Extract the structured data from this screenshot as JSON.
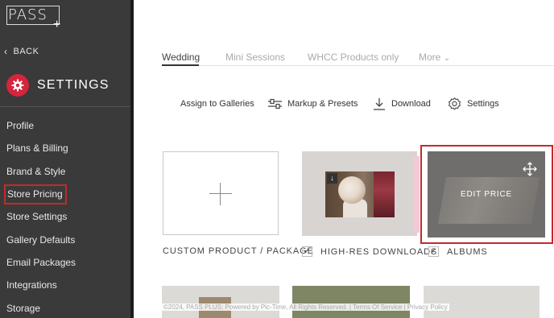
{
  "logo": {
    "text": "PASS",
    "plus": "+"
  },
  "sidebar": {
    "back_label": "BACK",
    "section_title": "SETTINGS",
    "items": [
      {
        "label": "Profile"
      },
      {
        "label": "Plans & Billing"
      },
      {
        "label": "Brand & Style"
      },
      {
        "label": "Store Pricing",
        "active": true
      },
      {
        "label": "Store Settings"
      },
      {
        "label": "Gallery Defaults"
      },
      {
        "label": "Email Packages"
      },
      {
        "label": "Integrations"
      },
      {
        "label": "Storage"
      }
    ]
  },
  "tabs": [
    {
      "label": "Wedding",
      "active": true
    },
    {
      "label": "Mini Sessions"
    },
    {
      "label": "WHCC Products only"
    },
    {
      "label": "More"
    }
  ],
  "toolbar": {
    "assign": "Assign to Galleries",
    "markup": "Markup & Presets",
    "download": "Download",
    "settings": "Settings"
  },
  "cards": {
    "custom": {
      "label": "CUSTOM PRODUCT / PACKAGE"
    },
    "hires": {
      "label": "HIGH-RES DOWNLOADS",
      "checked": true
    },
    "albums": {
      "label": "ALBUMS",
      "checked": true,
      "overlay": "EDIT PRICE"
    }
  },
  "footer": "©2024, PASS PLUS; Powered by Pic-Time, All Rights Reserved. | Terms Of Service | Privacy Policy",
  "colors": {
    "sidebar_bg": "#3a3a3a",
    "accent": "#d6243c",
    "highlight": "#c32a2a"
  }
}
